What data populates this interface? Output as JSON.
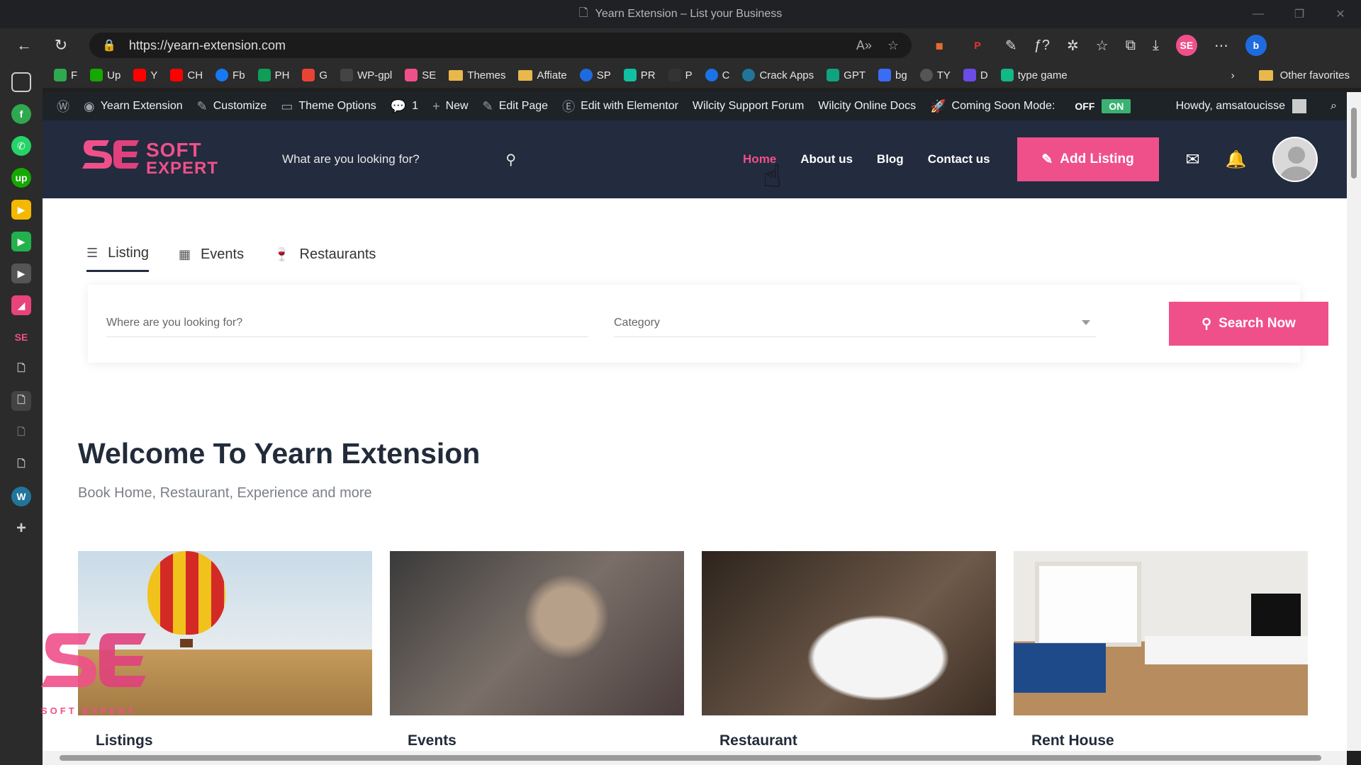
{
  "window": {
    "title": "Yearn Extension – List your Business"
  },
  "browser": {
    "url": "https://yearn-extension.com",
    "bookmarks": [
      {
        "label": "F",
        "color": "#2fa84f"
      },
      {
        "label": "Up",
        "color": "#14a800"
      },
      {
        "label": "Y",
        "color": "#ff0000"
      },
      {
        "label": "CH",
        "color": "#ff0000"
      },
      {
        "label": "Fb",
        "color": "#1877f2"
      },
      {
        "label": "PH",
        "color": "#0f9d58"
      },
      {
        "label": "G",
        "color": "#ea4335"
      },
      {
        "label": "WP-gpl",
        "color": "#444444"
      },
      {
        "label": "SE",
        "color": "#f0508a"
      },
      {
        "label": "Themes",
        "color": "folder"
      },
      {
        "label": "Affiate",
        "color": "folder"
      },
      {
        "label": "SP",
        "color": "#1e6be0"
      },
      {
        "label": "PR",
        "color": "#10c0a0"
      },
      {
        "label": "P",
        "color": "#333333"
      },
      {
        "label": "C",
        "color": "#1a73e8"
      },
      {
        "label": "Crack Apps",
        "color": "#21759b"
      },
      {
        "label": "GPT",
        "color": "#10a37f"
      },
      {
        "label": "bg",
        "color": "#3b6cf6"
      },
      {
        "label": "TY",
        "color": "#555555"
      },
      {
        "label": "D",
        "color": "#6b4ce6"
      },
      {
        "label": "type game",
        "color": "#12b886"
      }
    ],
    "other_favorites": "Other favorites"
  },
  "wp_admin": {
    "site_name": "Yearn Extension",
    "customize": "Customize",
    "theme_options": "Theme Options",
    "comments_count": "1",
    "new": "New",
    "edit_page": "Edit Page",
    "edit_elementor": "Edit with Elementor",
    "support_forum": "Wilcity Support Forum",
    "online_docs": "Wilcity Online Docs",
    "coming_soon_label": "Coming Soon Mode:",
    "off": "OFF",
    "on": "ON",
    "howdy": "Howdy, amsatoucisse"
  },
  "site": {
    "logo_line1": "SOFT",
    "logo_line2": "EXPERT",
    "search_placeholder": "What are you looking for?",
    "nav": [
      "Home",
      "About us",
      "Blog",
      "Contact us"
    ],
    "add_listing": "Add Listing"
  },
  "tabs": [
    "Listing",
    "Events",
    "Restaurants"
  ],
  "search": {
    "where_placeholder": "Where are you looking for?",
    "category_placeholder": "Category",
    "button": "Search Now"
  },
  "welcome": {
    "title": "Welcome To Yearn Extension",
    "subtitle": "Book Home, Restaurant, Experience and more"
  },
  "cards": [
    "Listings",
    "Events",
    "Restaurant",
    "Rent House"
  ],
  "watermark_text": "SOFT EXPERT",
  "colors": {
    "accent": "#f0508a",
    "header_bg": "#232b3e",
    "wpbar_bg": "#1d2327",
    "toggle_on": "#3bb273"
  }
}
